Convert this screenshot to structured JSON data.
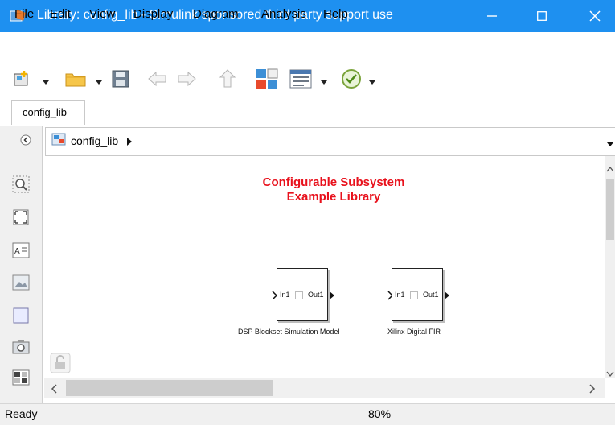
{
  "window": {
    "title": "Library: config_lib - Simulink sponsored third party support use",
    "accent_color": "#1e90f0",
    "controls": [
      "minimize-icon",
      "maximize-icon",
      "close-icon"
    ]
  },
  "menu": {
    "items": [
      {
        "label": "File",
        "key": "F",
        "rest": "ile"
      },
      {
        "label": "Edit",
        "key": "E",
        "rest": "dit"
      },
      {
        "label": "View",
        "key": "V",
        "rest": "iew"
      },
      {
        "label": "Display",
        "key": "D",
        "rest": "isplay"
      },
      {
        "label": "Diagram",
        "key": "",
        "rest": "Diagram"
      },
      {
        "label": "Analysis",
        "key": "A",
        "rest": "nalysis"
      },
      {
        "label": "Help",
        "key": "H",
        "rest": "elp"
      }
    ]
  },
  "toolbar": {
    "icons": [
      "new-model-icon",
      "open-folder-icon",
      "save-icon",
      "back-arrow-icon",
      "forward-arrow-icon",
      "up-arrow-icon",
      "library-browser-icon",
      "model-explorer-icon",
      "check-icon"
    ]
  },
  "tabs": [
    {
      "label": "config_lib"
    }
  ],
  "address": {
    "path": "config_lib"
  },
  "palette": {
    "icons": [
      "zoom-area-icon",
      "fit-to-view-icon",
      "annotation-icon",
      "image-icon",
      "area-icon",
      "screenshot-icon",
      "model-browser-icon"
    ]
  },
  "canvas": {
    "title_line1": "Configurable Subsystem",
    "title_line2": "Example Library",
    "title_color": "#e8111c",
    "blocks": [
      {
        "in_port": "In1",
        "out_port": "Out1",
        "caption": "DSP Blockset Simulation Model"
      },
      {
        "in_port": "In1",
        "out_port": "Out1",
        "caption": "Xilinx Digital FIR"
      }
    ]
  },
  "status": {
    "text": "Ready",
    "zoom": "80%"
  }
}
